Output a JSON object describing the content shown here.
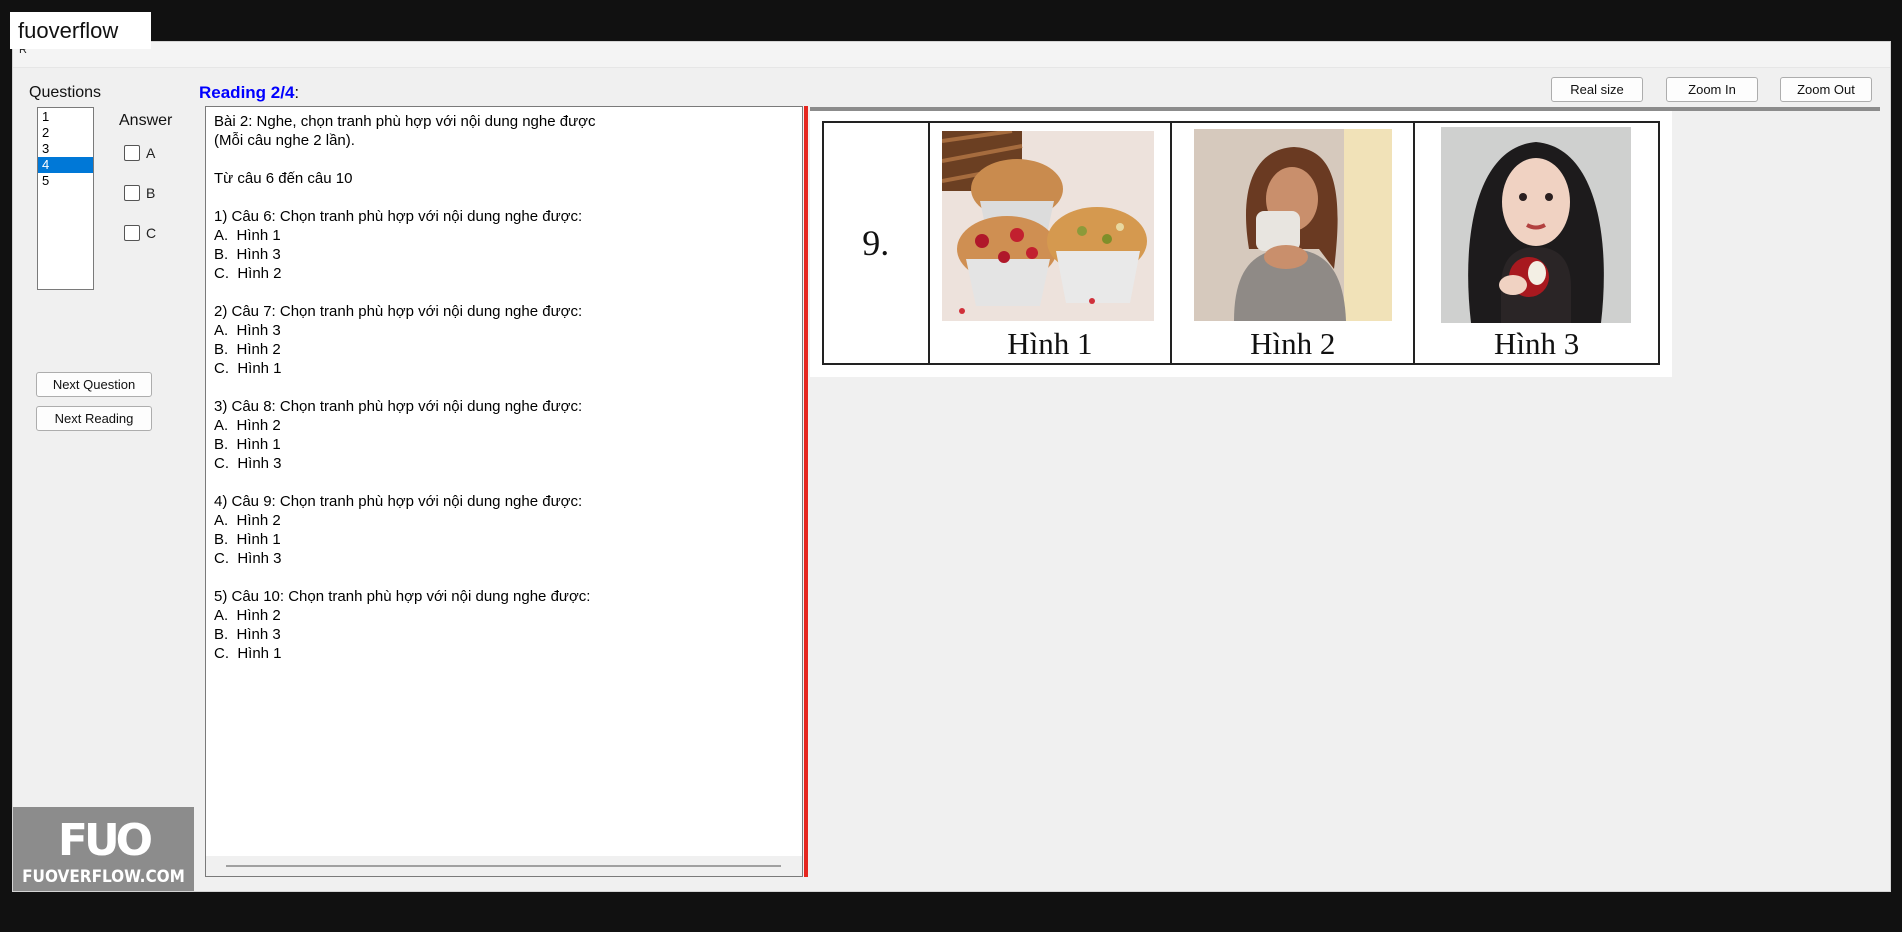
{
  "watermark": {
    "tag": "fuoverflow",
    "logo_mark": "FUO",
    "logo_text": "FUOVERFLOW.COM"
  },
  "window": {
    "caption": "R"
  },
  "sidebar": {
    "questions_label": "Questions",
    "questions": [
      "1",
      "2",
      "3",
      "4",
      "5"
    ],
    "selected_question": "4",
    "answer_label": "Answer",
    "answers": [
      {
        "label": "A",
        "checked": false
      },
      {
        "label": "B",
        "checked": false
      },
      {
        "label": "C",
        "checked": false
      }
    ],
    "next_question_label": "Next Question",
    "next_reading_label": "Next Reading"
  },
  "reading": {
    "title": "Reading 2/4",
    "title_suffix": ":"
  },
  "text_panel": {
    "content": "Bài 2: Nghe, chọn tranh phù hợp với nội dung nghe được\n(Mỗi câu nghe 2 lần).\n\nTừ câu 6 đến câu 10\n\n1) Câu 6: Chọn tranh phù hợp với nội dung nghe được:\nA.  Hình 1\nB.  Hình 3\nC.  Hình 2\n\n2) Câu 7: Chọn tranh phù hợp với nội dung nghe được:\nA.  Hình 3\nB.  Hình 2\nC.  Hình 1\n\n3) Câu 8: Chọn tranh phù hợp với nội dung nghe được:\nA.  Hình 2\nB.  Hình 1\nC.  Hình 3\n\n4) Câu 9: Chọn tranh phù hợp với nội dung nghe được:\nA.  Hình 2\nB.  Hình 1\nC.  Hình 3\n\n5) Câu 10: Chọn tranh phù hợp với nội dung nghe được:\nA.  Hình 2\nB.  Hình 3\nC.  Hình 1"
  },
  "toolbar": {
    "real_size_label": "Real size",
    "zoom_in_label": "Zoom In",
    "zoom_out_label": "Zoom Out"
  },
  "image": {
    "number": "9.",
    "pictures": [
      {
        "caption": "Hình 1",
        "subject": "muffins-on-plate"
      },
      {
        "caption": "Hình 2",
        "subject": "woman-drinking-from-cup"
      },
      {
        "caption": "Hình 3",
        "subject": "woman-eating-apple"
      }
    ]
  },
  "colors": {
    "selection": "#0078d7",
    "title_blue": "#0000ff",
    "divider_red": "#e5261f"
  }
}
